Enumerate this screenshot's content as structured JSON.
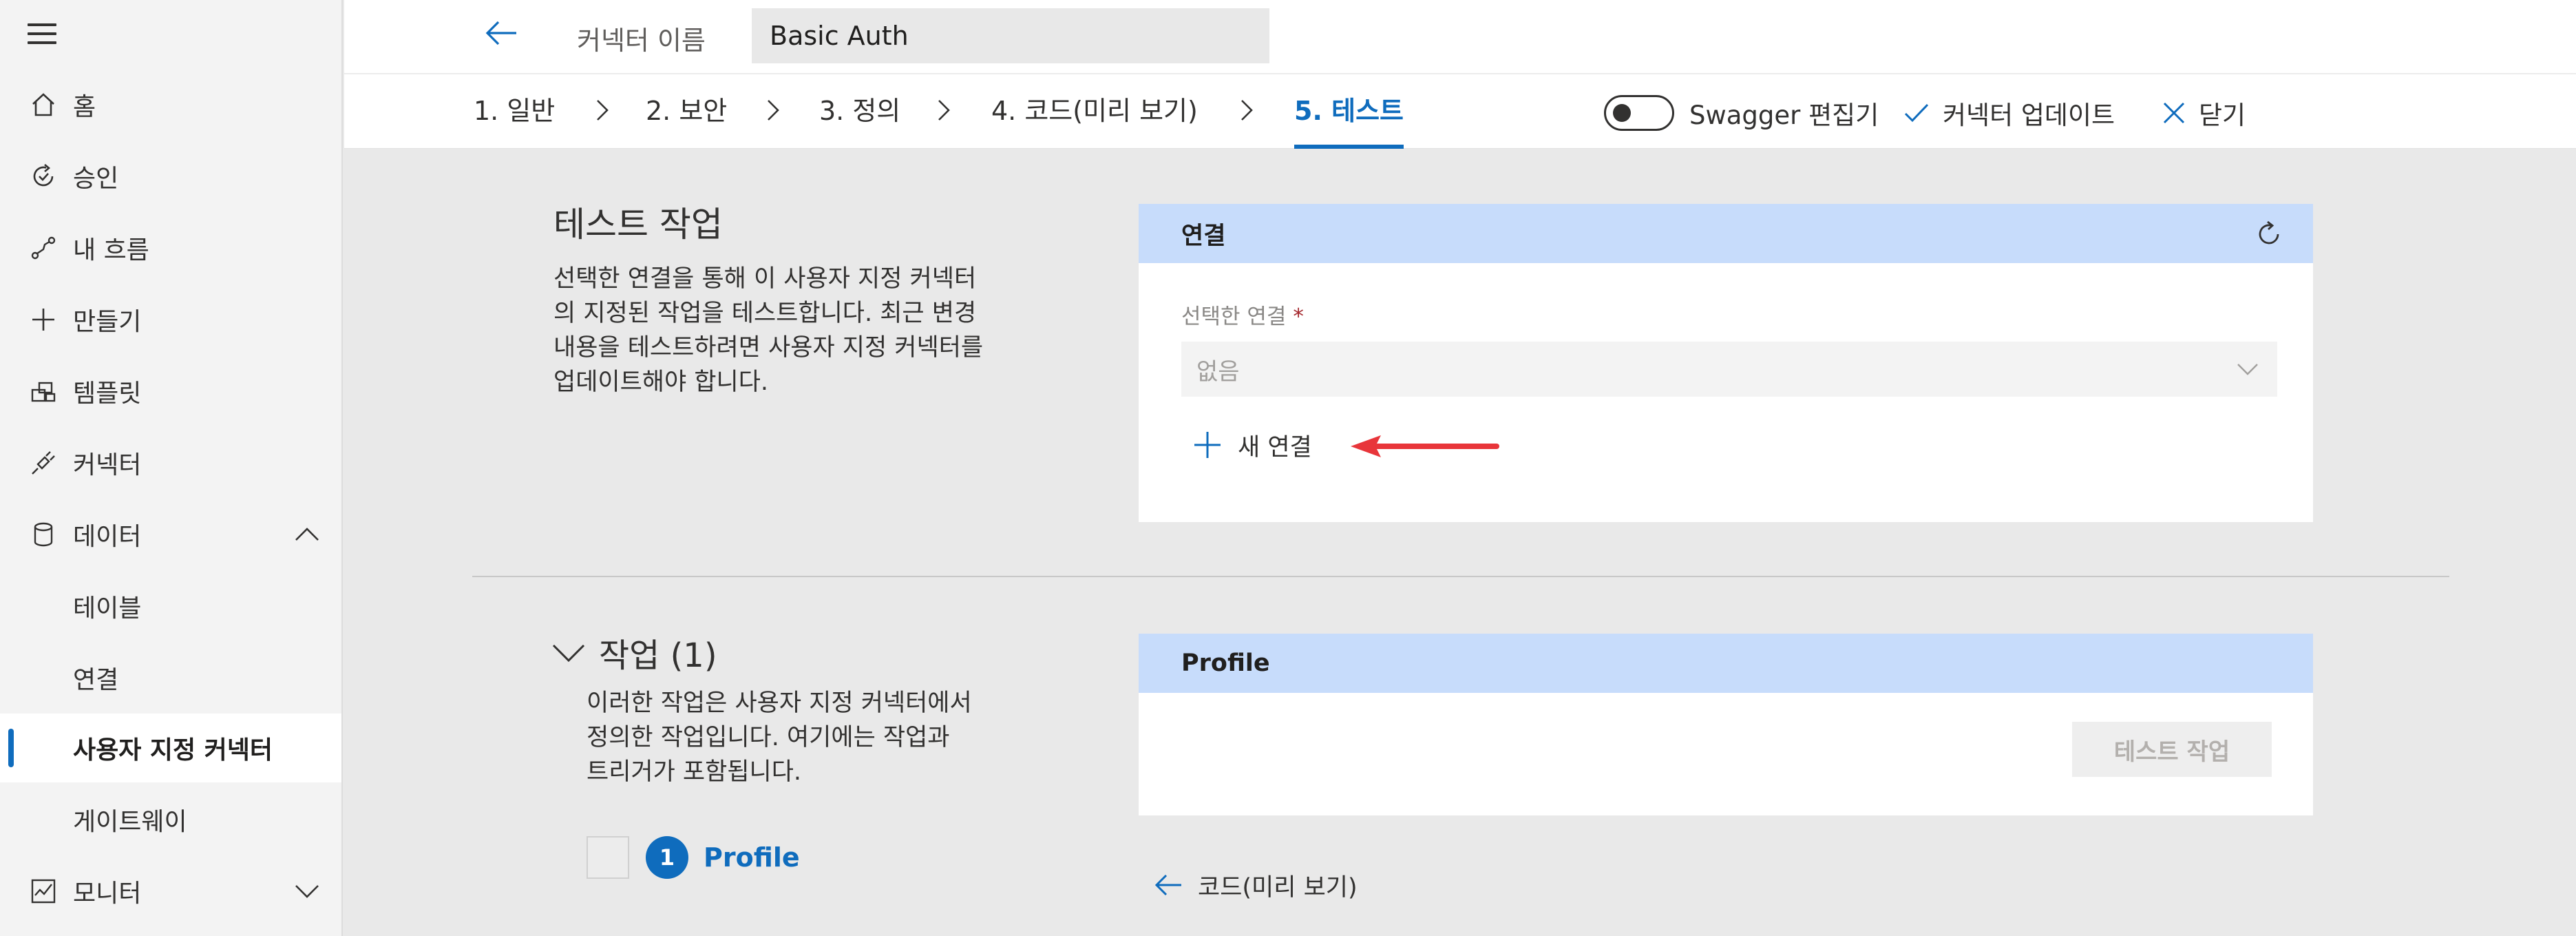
{
  "sidebar": {
    "items": [
      {
        "label": "홈",
        "icon": "home-icon"
      },
      {
        "label": "승인",
        "icon": "approvals-icon"
      },
      {
        "label": "내 흐름",
        "icon": "flows-icon"
      },
      {
        "label": "만들기",
        "icon": "plus-icon"
      },
      {
        "label": "템플릿",
        "icon": "templates-icon"
      },
      {
        "label": "커넥터",
        "icon": "connector-icon"
      },
      {
        "label": "데이터",
        "icon": "database-icon",
        "expanded": true
      },
      {
        "label": "테이블"
      },
      {
        "label": "연결"
      },
      {
        "label": "사용자 지정 커넥터",
        "active": true
      },
      {
        "label": "게이트웨이"
      },
      {
        "label": "모니터",
        "icon": "monitor-icon",
        "expanded": false
      }
    ]
  },
  "header": {
    "connector_name_label": "커넥터 이름",
    "connector_name_value": "Basic Auth",
    "steps": [
      {
        "label": "1. 일반"
      },
      {
        "label": "2. 보안"
      },
      {
        "label": "3. 정의"
      },
      {
        "label": "4. 코드(미리 보기)"
      },
      {
        "label": "5. 테스트",
        "active": true
      }
    ],
    "swagger_toggle_label": "Swagger 편집기",
    "swagger_toggle_on": false,
    "update_label": "커넥터 업데이트",
    "close_label": "닫기"
  },
  "test_section": {
    "title": "테스트 작업",
    "description": "선택한 연결을 통해 이 사용자 지정 커넥터의 지정된 작업을 테스트합니다. 최근 변경 내용을 테스트하려면 사용자 지정 커넥터를 업데이트해야 합니다."
  },
  "connection_card": {
    "title": "연결",
    "field_label": "선택한 연결",
    "required_mark": "*",
    "selected_value": "없음",
    "new_connection_label": "새 연결"
  },
  "operations_section": {
    "title": "작업 (1)",
    "description": "이러한 작업은 사용자 지정 커넥터에서 정의한 작업입니다. 여기에는 작업과 트리거가 포함됩니다.",
    "operations": [
      {
        "number": "1",
        "name": "Profile"
      }
    ]
  },
  "profile_card": {
    "title": "Profile",
    "test_button_label": "테스트 작업"
  },
  "back_link_label": "코드(미리 보기)",
  "colors": {
    "accent": "#0f6cbd",
    "card_header_bg": "#c7dcfb",
    "annotation_arrow": "#e8353a",
    "page_bg": "#e9e9e9"
  }
}
